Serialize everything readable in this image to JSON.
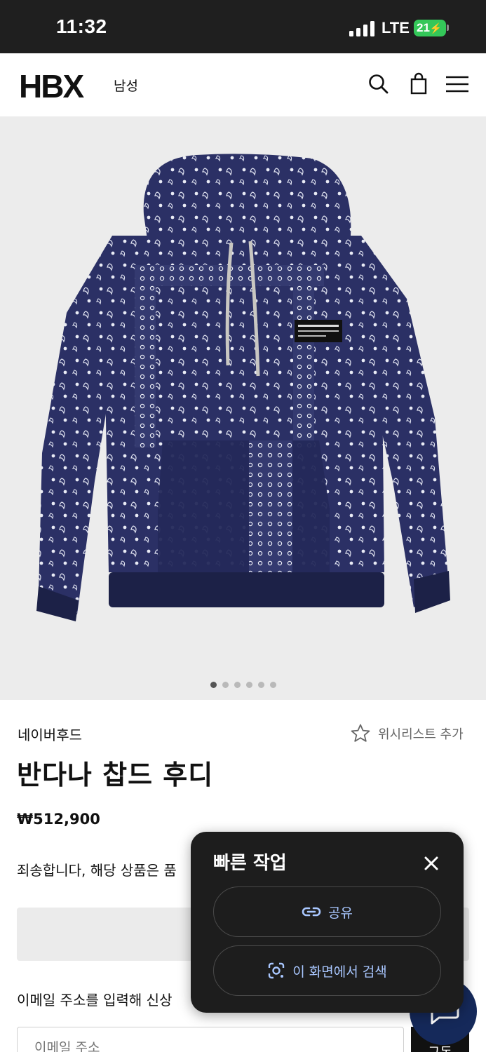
{
  "status_bar": {
    "time": "11:32",
    "network": "LTE",
    "battery": "21"
  },
  "header": {
    "logo": "HBX",
    "gender_nav": "남성",
    "icons": [
      "search-icon",
      "bag-icon",
      "menu-icon"
    ]
  },
  "product": {
    "image_pager_count": 6,
    "image_pager_active": 1,
    "brand": "네이버후드",
    "wishlist_label": "위시리스트 추가",
    "title": "반다나 찹드 후디",
    "price": "₩512,900",
    "soldout_text": "죄송합니다, 해당 상품은 품",
    "email_prompt": "이메일 주소를 입력해 신상",
    "email_placeholder": "이메일 주소",
    "subscribe_label": "구독"
  },
  "quick_actions": {
    "title": "빠른 작업",
    "share_label": "공유",
    "lens_label": "이 화면에서 검색"
  },
  "colors": {
    "status_bar": "#1f1f1f",
    "battery": "#34c759",
    "panel_bg": "#1d1d1d",
    "panel_accent": "#a9c7ff",
    "chat_fab": "#15295a",
    "hoodie_navy": "#2a2f62"
  }
}
